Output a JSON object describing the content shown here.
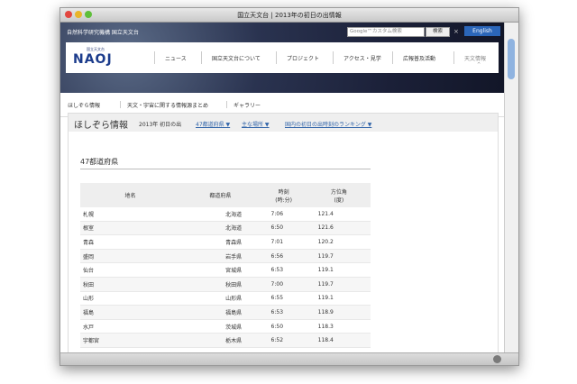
{
  "window": {
    "title": "国立天文台 | 2013年の初日の出情報"
  },
  "header": {
    "institution": "自然科学研究機構 国立天文台",
    "search_placeholder": "Google™カスタム検索",
    "search_button": "検索",
    "search_clear": "×",
    "english_button": "English"
  },
  "logo": {
    "small": "国立天文台",
    "main": "NAOJ"
  },
  "nav": {
    "items": [
      "ニュース",
      "国立天文台について",
      "プロジェクト",
      "アクセス・見学",
      "広報普及活動",
      "天文情報"
    ],
    "caret": "^"
  },
  "subnav": {
    "items": [
      "ほしぞら情報",
      "天文・宇宙に関する情報源まとめ",
      "ギャラリー"
    ]
  },
  "section": {
    "title": "ほしぞら情報",
    "subtitle": "2013年 初日の出",
    "links": [
      "47都道府県 ▼",
      "主な場所 ▼",
      "国内の初日の出時刻のランキング ▼"
    ]
  },
  "table": {
    "heading": "47都道府県",
    "headers": {
      "location": "地名",
      "prefecture": "都道府県",
      "time_1": "時刻",
      "time_2": "(時:分)",
      "azimuth_1": "方位角",
      "azimuth_2": "(度)"
    },
    "rows": [
      [
        "札幌",
        "北海道",
        "7:06",
        "121.4"
      ],
      [
        "根室",
        "北海道",
        "6:50",
        "121.6"
      ],
      [
        "青森",
        "青森県",
        "7:01",
        "120.2"
      ],
      [
        "盛岡",
        "岩手県",
        "6:56",
        "119.7"
      ],
      [
        "仙台",
        "宮城県",
        "6:53",
        "119.1"
      ],
      [
        "秋田",
        "秋田県",
        "7:00",
        "119.7"
      ],
      [
        "山形",
        "山形県",
        "6:55",
        "119.1"
      ],
      [
        "福島",
        "福島県",
        "6:53",
        "118.9"
      ],
      [
        "水戸",
        "茨城県",
        "6:50",
        "118.3"
      ],
      [
        "宇都宮",
        "栃木県",
        "6:52",
        "118.4"
      ]
    ]
  }
}
